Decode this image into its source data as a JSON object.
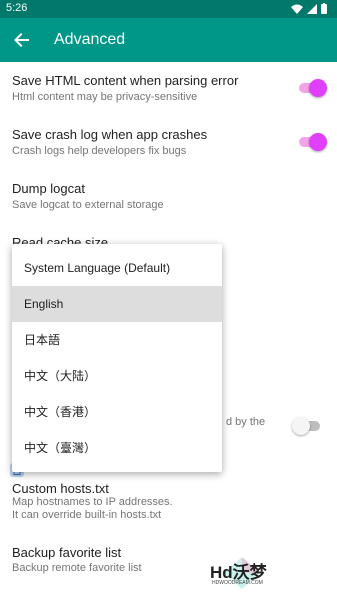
{
  "status_bar": {
    "time": "5:26"
  },
  "app_bar": {
    "title": "Advanced"
  },
  "settings": [
    {
      "title": "Save HTML content when parsing error",
      "subtitle": "Html content may be privacy-sensitive",
      "switch": "on"
    },
    {
      "title": "Save crash log when app crashes",
      "subtitle": "Crash logs help developers fix bugs",
      "switch": "on"
    },
    {
      "title": "Dump logcat",
      "subtitle": "Save logcat to external storage"
    },
    {
      "title": "Read cache size"
    },
    {
      "partial_subtitle": "d by the",
      "switch": "off"
    },
    {
      "title": "Custom hosts.txt",
      "subtitle_lines": [
        "Map hostnames to IP addresses.",
        "It can override built-in hosts.txt"
      ]
    },
    {
      "title": "Backup favorite list",
      "subtitle": "Backup remote favorite list"
    }
  ],
  "language_menu": {
    "items": [
      "System Language (Default)",
      "English",
      "日本語",
      "中文（大陆）",
      "中文（香港）",
      "中文（臺灣）"
    ],
    "selected_index": 1
  },
  "watermark": {
    "text": "Hd沃梦",
    "subtext": "HDWOODREAM.COM"
  },
  "colors": {
    "status_bar": "#00796b",
    "app_bar": "#009688",
    "switch_on_thumb": "#e040fb",
    "switch_on_track": "#f4a3e8"
  }
}
